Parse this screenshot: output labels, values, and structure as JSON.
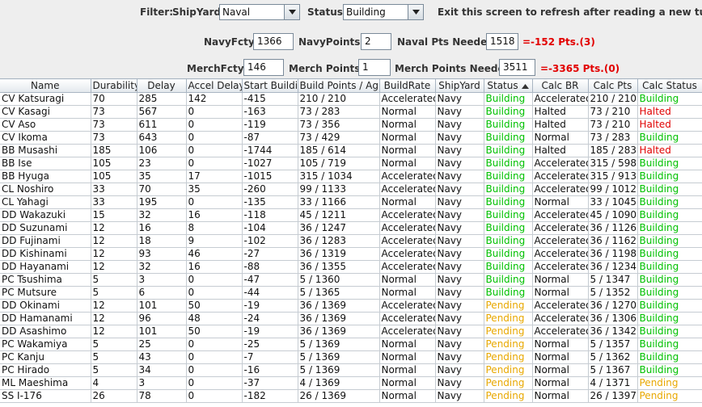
{
  "filter": {
    "label": "Filter:",
    "shipyard_label": "ShipYard:",
    "shipyard_value": "Naval",
    "status_label": "Status:",
    "status_value": "Building",
    "hint": "Exit this screen to refresh after reading a new turn"
  },
  "naval": {
    "fcty_label": "NavyFcty:",
    "fcty_value": "1366",
    "points_label": "NavyPoints:",
    "points_value": "2",
    "needed_label": "Naval Pts Needed:",
    "needed_value": "1518",
    "result": "=-152 Pts.(3)"
  },
  "merch": {
    "fcty_label": "MerchFcty:",
    "fcty_value": "146",
    "points_label": "Merch Points:",
    "points_value": "1",
    "needed_label": "Merch Points Needed:",
    "needed_value": "3511",
    "result": "=-3365 Pts.(0)"
  },
  "colors": {
    "building": "#00c000",
    "pending": "#e8a800",
    "halted": "#e00000",
    "deficit": "#e20000"
  },
  "table": {
    "columns": [
      "Name",
      "Durability",
      "Delay",
      "Accel Delay",
      "Start Buildi...",
      "Build Points / Ag...",
      "BuildRate",
      "ShipYard",
      "Status",
      "Calc BR",
      "Calc Pts",
      "Calc Status"
    ],
    "sort_column": "Status",
    "rows": [
      [
        "CV Katsuragi",
        "70",
        "285",
        "142",
        "-415",
        "210 / 210",
        "Accelerated",
        "Navy",
        "Building",
        "Accelerated",
        "210 / 210",
        "Building"
      ],
      [
        "CV Kasagi",
        "73",
        "567",
        "0",
        "-163",
        "73 / 283",
        "Normal",
        "Navy",
        "Building",
        "Halted",
        "73 / 210",
        "Halted"
      ],
      [
        "CV Aso",
        "73",
        "611",
        "0",
        "-119",
        "73 / 356",
        "Normal",
        "Navy",
        "Building",
        "Halted",
        "73 / 210",
        "Halted"
      ],
      [
        "CV Ikoma",
        "73",
        "643",
        "0",
        "-87",
        "73 / 429",
        "Normal",
        "Navy",
        "Building",
        "Normal",
        "73 / 283",
        "Building"
      ],
      [
        "BB Musashi",
        "185",
        "106",
        "0",
        "-1744",
        "185 / 614",
        "Normal",
        "Navy",
        "Building",
        "Halted",
        "185 / 283",
        "Halted"
      ],
      [
        "BB Ise",
        "105",
        "23",
        "0",
        "-1027",
        "105 / 719",
        "Normal",
        "Navy",
        "Building",
        "Accelerated",
        "315 / 598",
        "Building"
      ],
      [
        "BB Hyuga",
        "105",
        "35",
        "17",
        "-1015",
        "315 / 1034",
        "Accelerated",
        "Navy",
        "Building",
        "Accelerated",
        "315 / 913",
        "Building"
      ],
      [
        "CL Noshiro",
        "33",
        "70",
        "35",
        "-260",
        "99 / 1133",
        "Accelerated",
        "Navy",
        "Building",
        "Accelerated",
        "99 / 1012",
        "Building"
      ],
      [
        "CL Yahagi",
        "33",
        "195",
        "0",
        "-135",
        "33 / 1166",
        "Normal",
        "Navy",
        "Building",
        "Normal",
        "33 / 1045",
        "Building"
      ],
      [
        "DD Wakazuki",
        "15",
        "32",
        "16",
        "-118",
        "45 / 1211",
        "Accelerated",
        "Navy",
        "Building",
        "Accelerated",
        "45 / 1090",
        "Building"
      ],
      [
        "DD Suzunami",
        "12",
        "16",
        "8",
        "-104",
        "36 / 1247",
        "Accelerated",
        "Navy",
        "Building",
        "Accelerated",
        "36 / 1126",
        "Building"
      ],
      [
        "DD Fujinami",
        "12",
        "18",
        "9",
        "-102",
        "36 / 1283",
        "Accelerated",
        "Navy",
        "Building",
        "Accelerated",
        "36 / 1162",
        "Building"
      ],
      [
        "DD Kishinami",
        "12",
        "93",
        "46",
        "-27",
        "36 / 1319",
        "Accelerated",
        "Navy",
        "Building",
        "Accelerated",
        "36 / 1198",
        "Building"
      ],
      [
        "DD Hayanami",
        "12",
        "32",
        "16",
        "-88",
        "36 / 1355",
        "Accelerated",
        "Navy",
        "Building",
        "Accelerated",
        "36 / 1234",
        "Building"
      ],
      [
        "PC Tsushima",
        "5",
        "3",
        "0",
        "-47",
        "5 / 1360",
        "Normal",
        "Navy",
        "Building",
        "Normal",
        "5 / 1347",
        "Building"
      ],
      [
        "PC Mutsure",
        "5",
        "6",
        "0",
        "-44",
        "5 / 1365",
        "Normal",
        "Navy",
        "Building",
        "Normal",
        "5 / 1352",
        "Building"
      ],
      [
        "DD Okinami",
        "12",
        "101",
        "50",
        "-19",
        "36 / 1369",
        "Accelerated",
        "Navy",
        "Pending",
        "Accelerated",
        "36 / 1270",
        "Building"
      ],
      [
        "DD Hamanami",
        "12",
        "96",
        "48",
        "-24",
        "36 / 1369",
        "Accelerated",
        "Navy",
        "Pending",
        "Accelerated",
        "36 / 1306",
        "Building"
      ],
      [
        "DD Asashimo",
        "12",
        "101",
        "50",
        "-19",
        "36 / 1369",
        "Accelerated",
        "Navy",
        "Pending",
        "Accelerated",
        "36 / 1342",
        "Building"
      ],
      [
        "PC Wakamiya",
        "5",
        "25",
        "0",
        "-25",
        "5 / 1369",
        "Normal",
        "Navy",
        "Pending",
        "Normal",
        "5 / 1357",
        "Building"
      ],
      [
        "PC Kanju",
        "5",
        "43",
        "0",
        "-7",
        "5 / 1369",
        "Normal",
        "Navy",
        "Pending",
        "Normal",
        "5 / 1362",
        "Building"
      ],
      [
        "PC Hirado",
        "5",
        "34",
        "0",
        "-16",
        "5 / 1369",
        "Normal",
        "Navy",
        "Pending",
        "Normal",
        "5 / 1367",
        "Building"
      ],
      [
        "ML Maeshima",
        "4",
        "3",
        "0",
        "-37",
        "4 / 1369",
        "Normal",
        "Navy",
        "Pending",
        "Normal",
        "4 / 1371",
        "Pending"
      ],
      [
        "SS I-176",
        "26",
        "78",
        "0",
        "-182",
        "26 / 1369",
        "Normal",
        "Navy",
        "Pending",
        "Normal",
        "26 / 1397",
        "Pending"
      ]
    ]
  }
}
